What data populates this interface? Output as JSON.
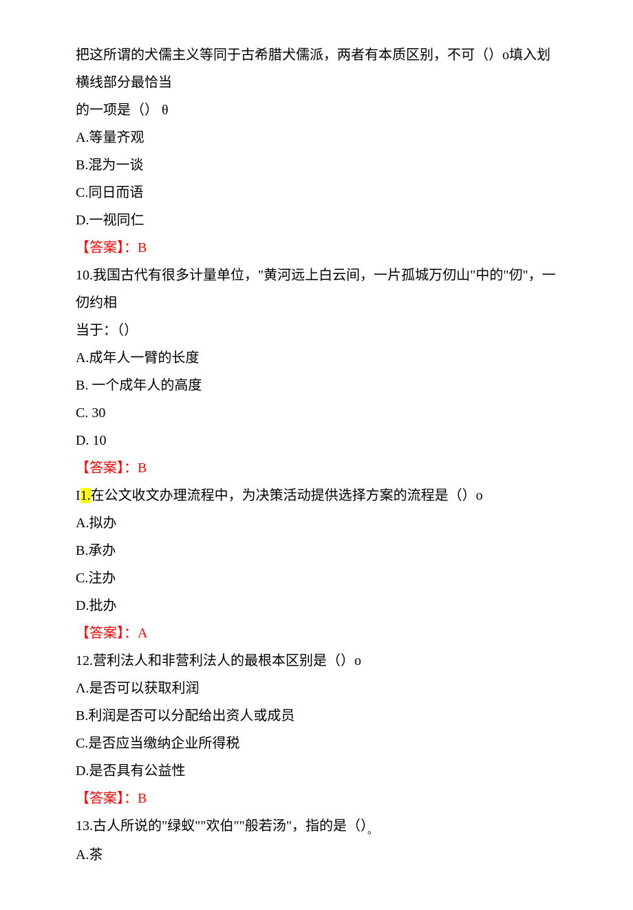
{
  "q9": {
    "intro_line1": "把这所谓的犬儒主义等同于古希腊犬儒派，两者有本质区别，不可（）o填入划横线部分最恰当",
    "intro_line2": "的一项是（） θ",
    "optA": "A.等量齐观",
    "optB": "B.混为一谈",
    "optC": "C.同日而语",
    "optD": "D.一视同仁",
    "answer_label": "【答案】：",
    "answer_value": "B"
  },
  "q10": {
    "line1": "10.我国古代有很多计量单位，\"黄河远上白云间，一片孤城万仞山\"中的\"仞\"，一仞约相",
    "line2": "当于：（）",
    "optA": "A.成年人一臂的长度",
    "optB": "B.  一个成年人的高度",
    "optC": "C.  30",
    "optD": "D.  10",
    "answer_label": "【答案】：",
    "answer_value": "B"
  },
  "q11": {
    "prefix": "I",
    "highlighted": "1.",
    "rest": "在公文收文办理流程中，为决策活动提供选择方案的流程是（）o",
    "optA": "A.拟办",
    "optB": "B.承办",
    "optC": "C.注办",
    "optD": "D.批办",
    "answer_label": "【答案】：",
    "answer_value": "A"
  },
  "q12": {
    "stem": "12.营利法人和非营利法人的最根本区别是（）o",
    "optA": "Λ.是否可以获取利润",
    "optB": "B.利润是否可以分配给出资人或成员",
    "optC": "C.是否应当缴纳企业所得税",
    "optD": "D.是否具有公益性",
    "answer_label": "【答案】：",
    "answer_value": "B"
  },
  "q13": {
    "stem_text": "13.古人所说的\"绿蚁\"\"欢伯\"\"般若汤\"，指的是（）",
    "stem_suffix": "。",
    "optA": "A.茶"
  }
}
